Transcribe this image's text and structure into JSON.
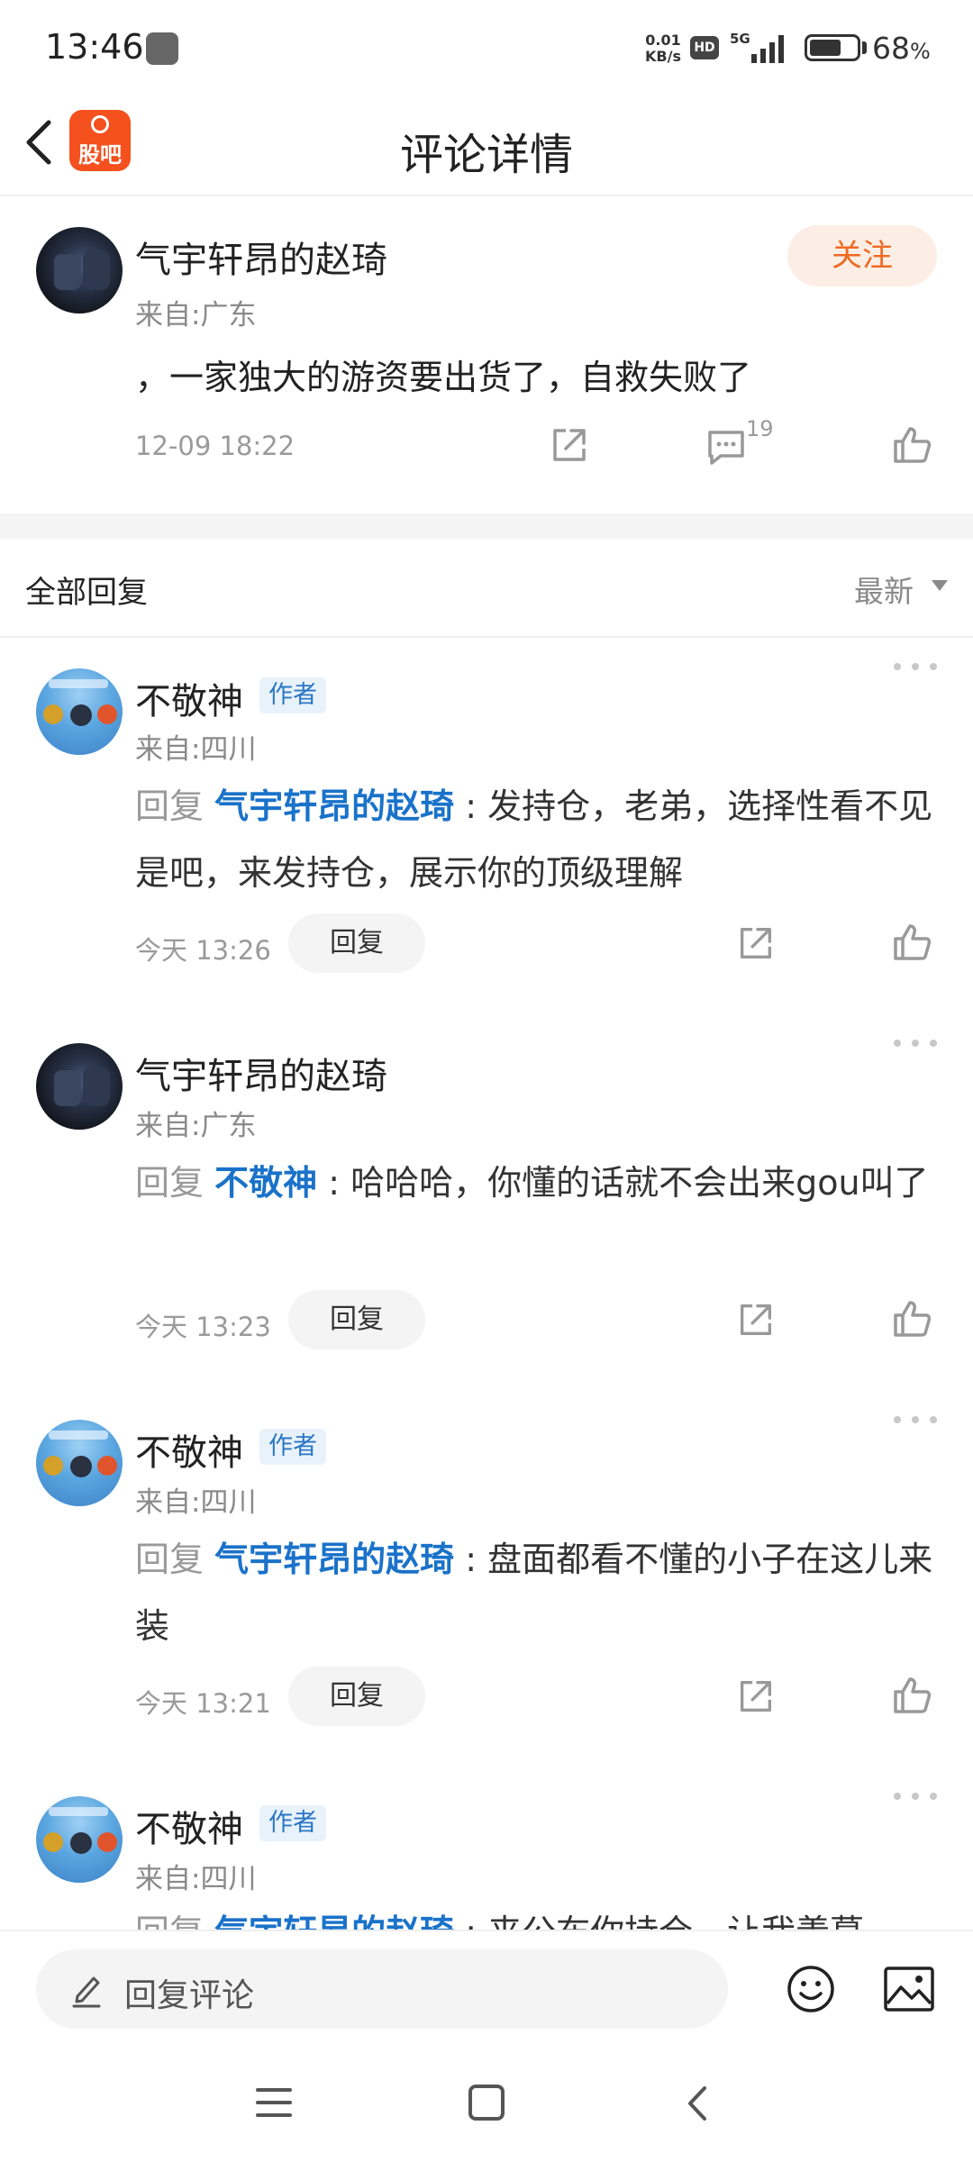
{
  "status_bar": {
    "time": "13:46",
    "net_speed_value": "0.01",
    "net_speed_unit": "KB/s",
    "hd": "HD",
    "network": "5G",
    "battery_percent": "68",
    "battery_percent_sign": "%",
    "battery_level": 0.68
  },
  "header": {
    "logo_text": "股吧",
    "title": "评论详情"
  },
  "main_post": {
    "username": "气宇轩昂的赵琦",
    "location": "来自:广东",
    "follow_label": "关注",
    "content": "，一家独大的游资要出货了，自救失败了",
    "time": "12-09 18:22",
    "reply_count": "19"
  },
  "replies_header": {
    "title": "全部回复",
    "sort": "最新"
  },
  "replies": [
    {
      "username": "不敬神",
      "author_tag": "作者",
      "location": "来自:四川",
      "prefix": "回复",
      "mention": "气宇轩昂的赵琦",
      "colon": " : ",
      "text": "发持仓，老弟，选择性看不见是吧，来发持仓，展示你的顶级理解",
      "time": "今天 13:26",
      "reply_label": "回复"
    },
    {
      "username": "气宇轩昂的赵琦",
      "author_tag": "",
      "location": "来自:广东",
      "prefix": "回复",
      "mention": "不敬神",
      "colon": " : ",
      "text": "哈哈哈，你懂的话就不会出来gou叫了",
      "time": "今天 13:23",
      "reply_label": "回复"
    },
    {
      "username": "不敬神",
      "author_tag": "作者",
      "location": "来自:四川",
      "prefix": "回复",
      "mention": "气宇轩昂的赵琦",
      "colon": " : ",
      "text": "盘面都看不懂的小子在这儿来装",
      "time": "今天 13:21",
      "reply_label": "回复"
    },
    {
      "username": "不敬神",
      "author_tag": "作者",
      "location": "来自:四川",
      "prefix": "回复",
      "mention": "气宇轩昂的赵琦",
      "colon": " : ",
      "text": "来公布你持仓，让我羡慕",
      "time": "",
      "reply_label": ""
    }
  ],
  "bottom_bar": {
    "input_placeholder": "回复评论"
  },
  "icons": {
    "back": "back-arrow-icon",
    "share": "share-icon",
    "comment": "comment-icon",
    "like": "thumbs-up-icon",
    "more": "more-dots-icon",
    "emoji": "emoji-icon",
    "image": "image-icon",
    "pencil": "pencil-icon",
    "menu": "menu-icon",
    "home": "home-square-icon",
    "nav_back": "nav-back-icon"
  },
  "colors": {
    "accent_orange": "#ee6a23",
    "mention_blue": "#1a72c9",
    "logo": "#f4511e"
  }
}
